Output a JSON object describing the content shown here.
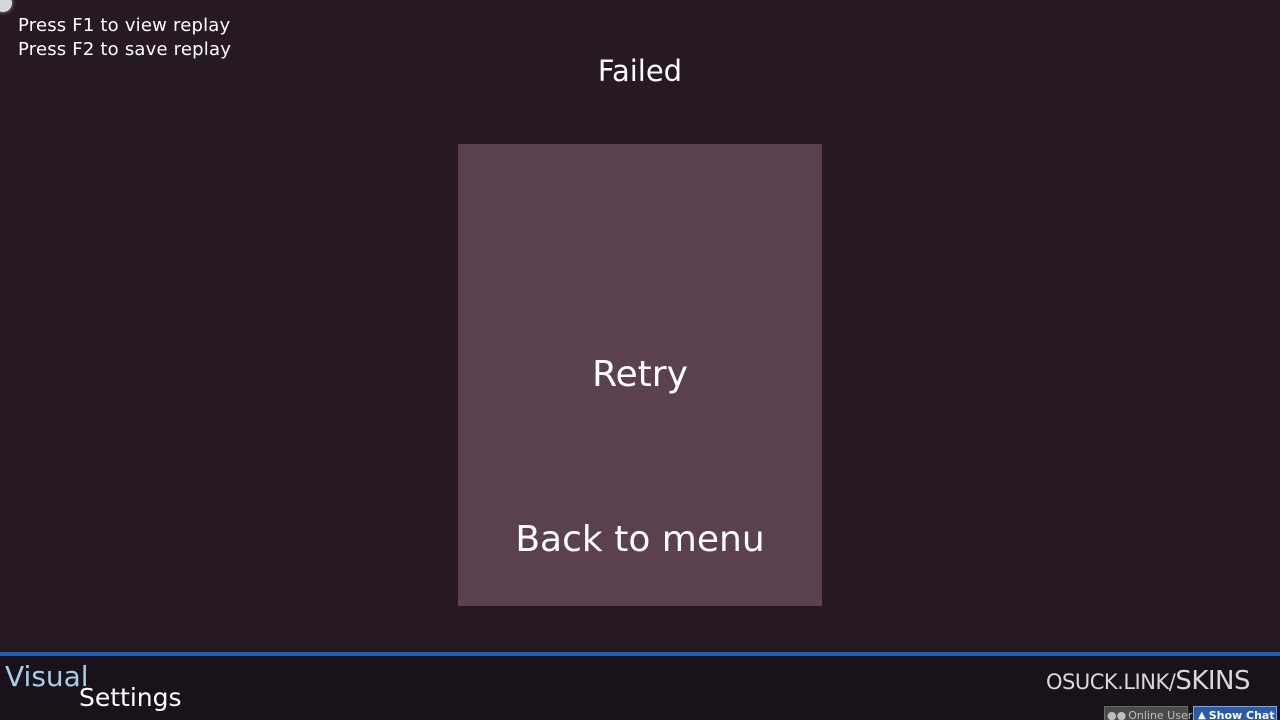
{
  "replay": {
    "hint_view": "Press F1 to view replay",
    "hint_save": "Press F2 to save replay"
  },
  "status": {
    "title": "Failed"
  },
  "menu": {
    "retry_label": "Retry",
    "back_label": "Back to menu"
  },
  "bottom_bar": {
    "visual_label": "Visual",
    "settings_label": "Settings",
    "watermark_main": "OSUCK.LINK/",
    "watermark_end": "SKINS",
    "online_users_label": "Online Users",
    "show_chat_label": "Show Chat"
  },
  "icons": {
    "users": "users-icon",
    "chevron": "chevron-up-icon"
  },
  "colors": {
    "background": "#261923",
    "panel": "#5b404f",
    "accent_bar": "#1e62b8",
    "visual_text": "#a9cde8"
  }
}
